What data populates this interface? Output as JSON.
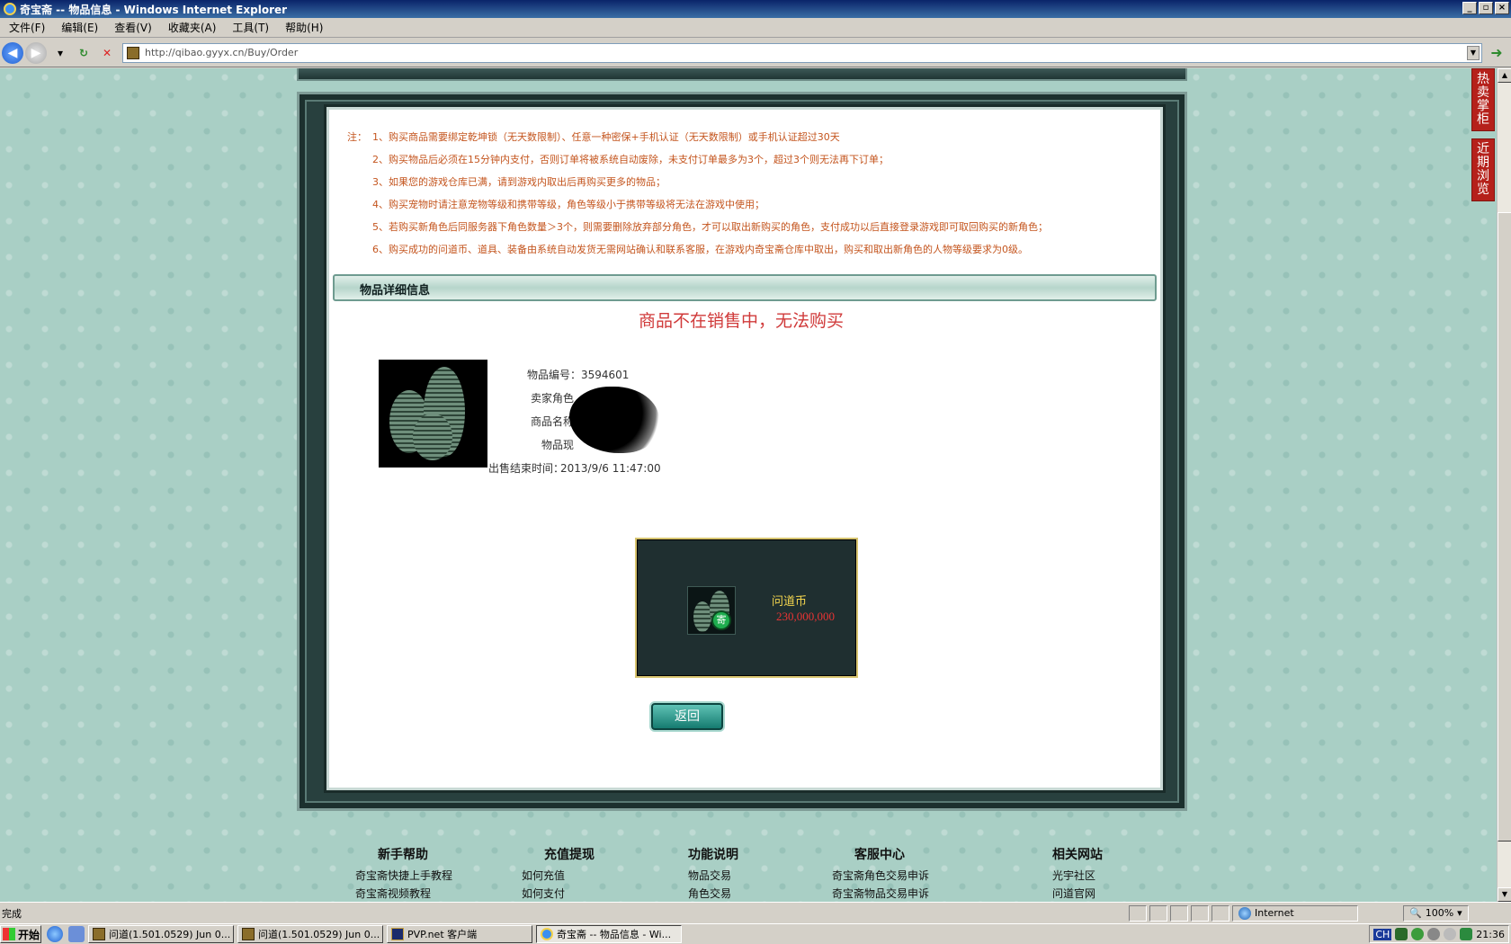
{
  "window": {
    "title": "奇宝斋 -- 物品信息 - Windows Internet Explorer",
    "buttons": [
      "_",
      "▫",
      "×"
    ]
  },
  "menu": [
    "文件(F)",
    "编辑(E)",
    "查看(V)",
    "收藏夹(A)",
    "工具(T)",
    "帮助(H)"
  ],
  "address": {
    "url": "http://qibao.gyyx.cn/Buy/Order"
  },
  "notes": {
    "prefix": "注：",
    "lines": [
      "1、购买商品需要绑定乾坤锁（无天数限制）、任意一种密保+手机认证（无天数限制）或手机认证超过30天",
      "2、购买物品后必须在15分钟内支付，否则订单将被系统自动废除，未支付订单最多为3个，超过3个则无法再下订单；",
      "3、如果您的游戏仓库已满，请到游戏内取出后再购买更多的物品；",
      "4、购买宠物时请注意宠物等级和携带等级，角色等级小于携带等级将无法在游戏中使用；",
      "5、若购买新角色后同服务器下角色数量＞3个，则需要删除放弃部分角色，才可以取出新购买的角色，支付成功以后直接登录游戏即可取回购买的新角色；",
      "6、购买成功的问道币、道具、装备由系统自动发货无需网站确认和联系客服，在游戏内奇宝斋仓库中取出，购买和取出新角色的人物等级要求为0级。"
    ]
  },
  "section": {
    "title": "物品详细信息"
  },
  "status_message": "商品不在销售中，无法购买",
  "item": {
    "rows": [
      {
        "label": "物品编号：",
        "value": "3594601"
      },
      {
        "label": "卖家角色",
        "value": ""
      },
      {
        "label": "商品名称",
        "value": ""
      },
      {
        "label": "物品现",
        "value": ""
      },
      {
        "label": "出售结束时间：",
        "value": "2013/9/6 11:47:00"
      }
    ]
  },
  "coin": {
    "name": "问道币",
    "value": "230,000,000",
    "badge": "寄"
  },
  "back_button": "返回",
  "footer": [
    {
      "head": "新手帮助",
      "links": [
        "奇宝斋快捷上手教程",
        "奇宝斋视频教程"
      ]
    },
    {
      "head": "充值提现",
      "links": [
        "如何充值",
        "如何支付"
      ]
    },
    {
      "head": "功能说明",
      "links": [
        "物品交易",
        "角色交易"
      ]
    },
    {
      "head": "客服中心",
      "links": [
        "奇宝斋角色交易申诉",
        "奇宝斋物品交易申诉"
      ]
    },
    {
      "head": "相关网站",
      "links": [
        "光宇社区",
        "问道官网"
      ]
    }
  ],
  "side_tabs": [
    "热卖掌柜",
    "近期浏览"
  ],
  "statusbar": {
    "status": "完成",
    "zone": "Internet",
    "zoom": "100%"
  },
  "taskbar": {
    "start": "开始",
    "tasks": [
      "问道(1.501.0529) Jun 0...",
      "问道(1.501.0529) Jun 0...",
      "PVP.net 客户端",
      "奇宝斋 -- 物品信息 - Wi..."
    ],
    "tray_lang": "CH",
    "clock": "21:36"
  }
}
